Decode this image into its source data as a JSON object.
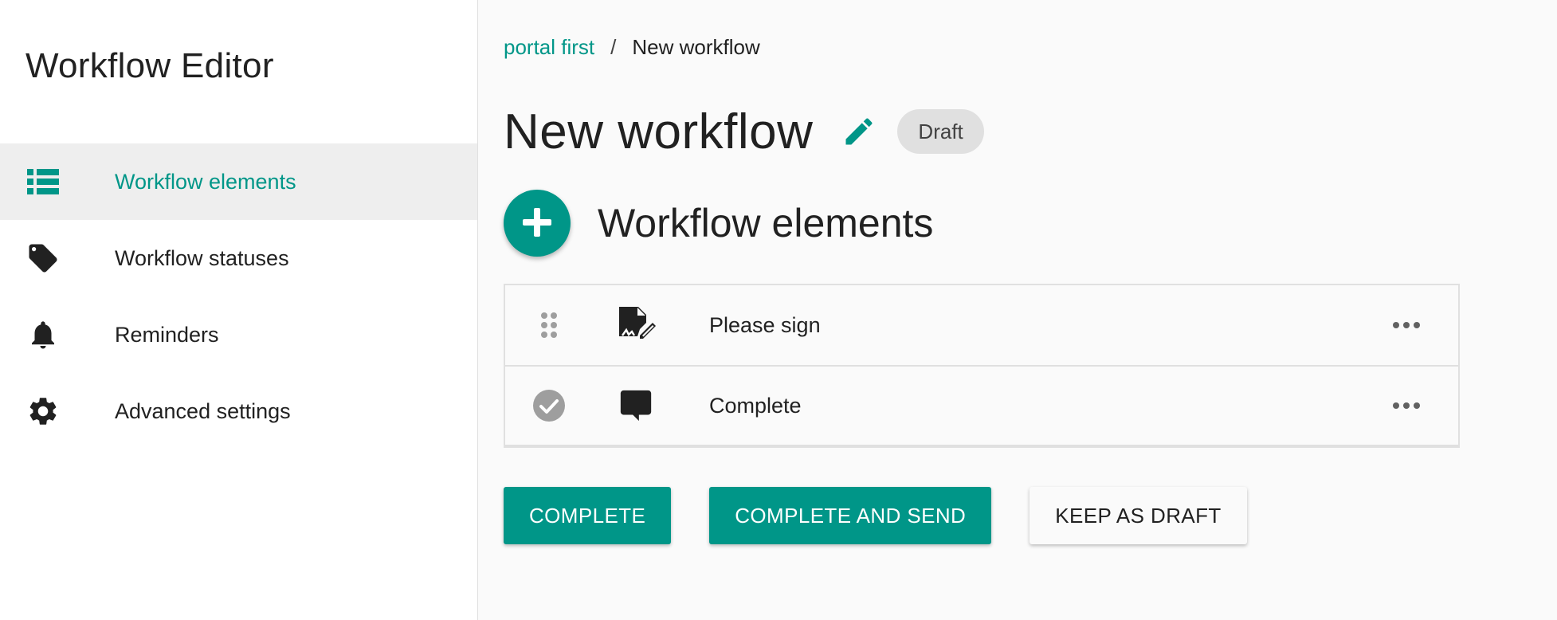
{
  "colors": {
    "accent": "#009688",
    "sidebar_active_bg": "#eeeeee",
    "badge_bg": "#e0e0e0"
  },
  "sidebar": {
    "title": "Workflow Editor",
    "items": [
      {
        "label": "Workflow elements",
        "icon": "list-icon",
        "active": true
      },
      {
        "label": "Workflow statuses",
        "icon": "tag-icon",
        "active": false
      },
      {
        "label": "Reminders",
        "icon": "bell-icon",
        "active": false
      },
      {
        "label": "Advanced settings",
        "icon": "gear-icon",
        "active": false
      }
    ]
  },
  "breadcrumb": {
    "parent": "portal first",
    "separator": "/",
    "current": "New workflow"
  },
  "header": {
    "title": "New workflow",
    "edit_icon": "pencil-icon",
    "status": "Draft"
  },
  "section": {
    "title": "Workflow elements",
    "add_icon": "plus-icon"
  },
  "elements": [
    {
      "label": "Please sign",
      "handle_icon": "drag-handle-icon",
      "type_icon": "signature-document-icon",
      "menu_icon": "more-horizontal-icon"
    },
    {
      "label": "Complete",
      "handle_icon": "check-circle-icon",
      "type_icon": "comment-icon",
      "menu_icon": "more-horizontal-icon"
    }
  ],
  "actions": {
    "complete": "COMPLETE",
    "complete_and_send": "COMPLETE AND SEND",
    "keep_as_draft": "KEEP AS DRAFT"
  }
}
